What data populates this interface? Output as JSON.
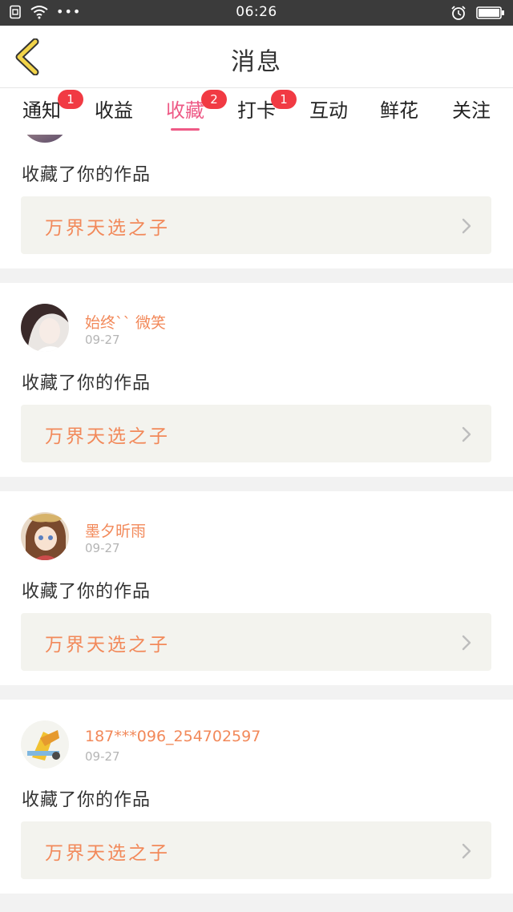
{
  "status_bar": {
    "time": "06:26",
    "icons": [
      "sim-icon",
      "wifi-icon",
      "more-dots-icon",
      "alarm-icon",
      "battery-icon"
    ],
    "more_dots": "•••"
  },
  "header": {
    "title": "消息",
    "back_icon": "back-chevron-icon"
  },
  "tabs": [
    {
      "label": "通知",
      "badge": "1",
      "active": false
    },
    {
      "label": "收益",
      "badge": "",
      "active": false
    },
    {
      "label": "收藏",
      "badge": "2",
      "active": true
    },
    {
      "label": "打卡",
      "badge": "1",
      "active": false
    },
    {
      "label": "互动",
      "badge": "",
      "active": false
    },
    {
      "label": "鲜花",
      "badge": "",
      "active": false
    },
    {
      "label": "关注",
      "badge": "",
      "active": false
    }
  ],
  "feed": {
    "items": [
      {
        "username": "",
        "date": "",
        "action": "收藏了你的作品",
        "work_title": "万界天选之子"
      },
      {
        "username": "始终`` 微笑",
        "date": "09-27",
        "action": "收藏了你的作品",
        "work_title": "万界天选之子"
      },
      {
        "username": "墨夕昕雨",
        "date": "09-27",
        "action": "收藏了你的作品",
        "work_title": "万界天选之子"
      },
      {
        "username": "187***096_254702597",
        "date": "09-27",
        "action": "收藏了你的作品",
        "work_title": "万界天选之子"
      }
    ]
  },
  "colors": {
    "accent_pink": "#ee5a86",
    "badge_red": "#f13a43",
    "orange_text": "#f2895a",
    "status_bar_bg": "#3b3b3b",
    "back_icon_yellow": "#f2d44a"
  }
}
